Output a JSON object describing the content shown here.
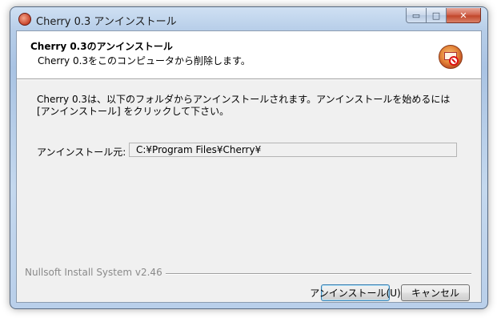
{
  "window": {
    "title": "Cherry 0.3 アンインストール",
    "minimize_glyph": "▭",
    "maximize_glyph": "□",
    "close_glyph": "✕"
  },
  "header": {
    "title": "Cherry 0.3のアンインストール",
    "subtitle": "Cherry 0.3をこのコンピュータから削除します。"
  },
  "body": {
    "description_line1": "Cherry 0.3は、以下のフォルダからアンインストールされます。アンインストールを始めるには",
    "description_line2": "[アンインストール] をクリックして下さい。",
    "destination_label": "アンインストール元:",
    "destination_value": "C:¥Program Files¥Cherry¥"
  },
  "branding": "Nullsoft Install System v2.46",
  "buttons": {
    "uninstall": "アンインストール(U)",
    "cancel": "キャンセル"
  },
  "colors": {
    "accent": "#3c7fb1",
    "close_button": "#c2472b"
  }
}
